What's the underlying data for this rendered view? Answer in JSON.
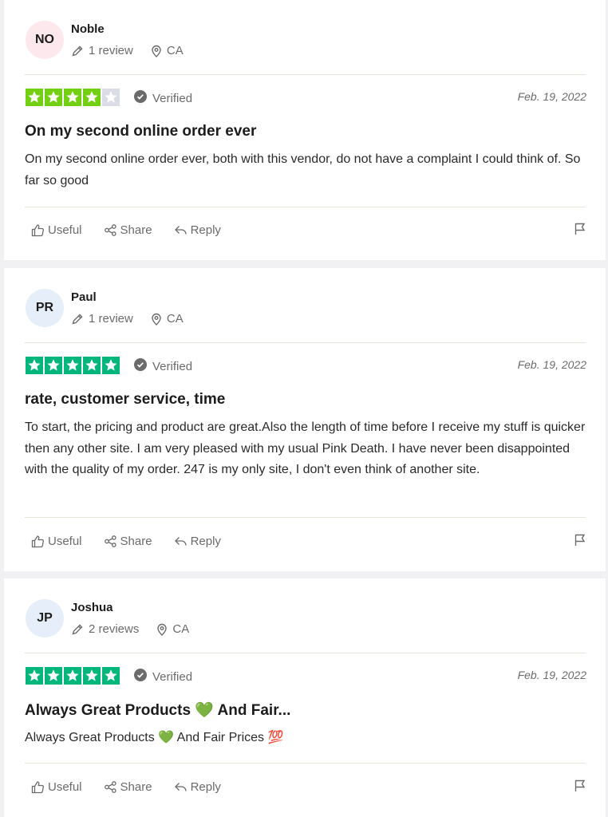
{
  "colors": {
    "star_green": "#00b67a",
    "star_lightgreen": "#73cf11",
    "star_empty": "#dcdce6"
  },
  "icons": {
    "edit": "pencil-icon",
    "location": "location-pin-icon",
    "verified": "check-circle-icon",
    "useful": "thumbs-up-icon",
    "share": "share-icon",
    "reply": "reply-arrow-icon",
    "report": "flag-icon"
  },
  "actions": {
    "useful": "Useful",
    "share": "Share",
    "reply": "Reply"
  },
  "reviews": [
    {
      "initials": "NO",
      "avatar_color": "#fde8ee",
      "name": "Noble",
      "review_count": "1 review",
      "location": "CA",
      "rating": 4,
      "verified": "Verified",
      "date": "Feb. 19, 2022",
      "title": "On my second online order ever",
      "text": "On my second online order ever, both with this vendor, do not have a complaint I could think of. So far so good"
    },
    {
      "initials": "PR",
      "avatar_color": "#e6eef9",
      "name": "Paul",
      "review_count": "1 review",
      "location": "CA",
      "rating": 5,
      "verified": "Verified",
      "date": "Feb. 19, 2022",
      "title": "rate, customer service, time",
      "text": "To start, the pricing and product are great.Also the length of time before I receive my stuff is quicker then any other site. I am very pleased with my usual Pink Death. I have never been disappointed with the quality of my order. 247 is my only site, I don't even think of another site."
    },
    {
      "initials": "JP",
      "avatar_color": "#e6eef9",
      "name": "Joshua",
      "review_count": "2 reviews",
      "location": "CA",
      "rating": 5,
      "verified": "Verified",
      "date": "Feb. 19, 2022",
      "title": "Always Great Products 💚 And Fair...",
      "text": "Always Great Products 💚 And Fair Prices 💯"
    }
  ]
}
